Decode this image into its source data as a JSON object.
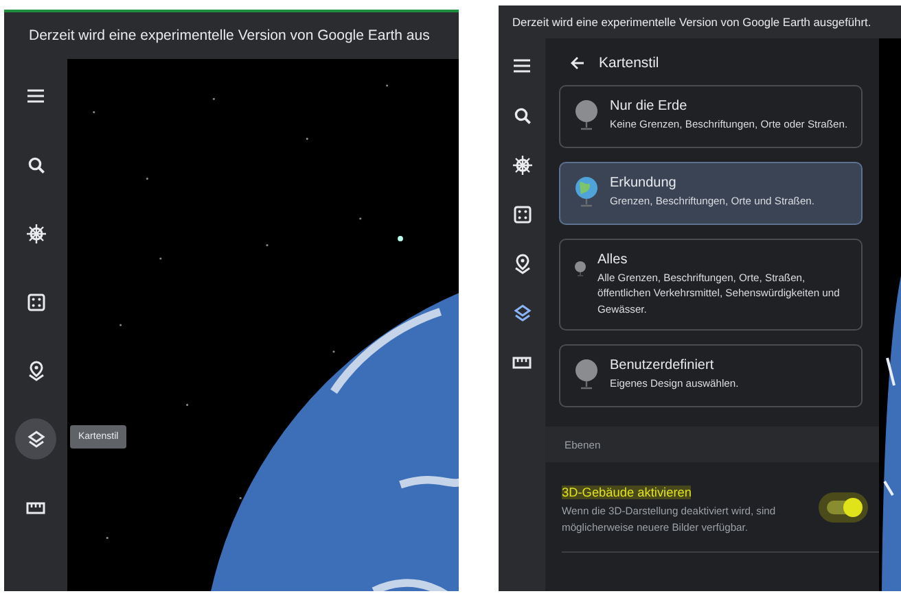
{
  "screens": [
    {
      "banner": "Derzeit wird eine experimentelle Version von Google Earth aus",
      "tooltip": "Kartenstil",
      "sidebar": [
        {
          "kind": "menu",
          "selected": false
        },
        {
          "kind": "search",
          "selected": false
        },
        {
          "kind": "wheel",
          "selected": false
        },
        {
          "kind": "dice",
          "selected": false
        },
        {
          "kind": "pin",
          "selected": false
        },
        {
          "kind": "layers",
          "selected": true
        },
        {
          "kind": "ruler",
          "selected": false
        }
      ]
    },
    {
      "banner": "Derzeit wird eine experimentelle Version von Google Earth ausgeführt.",
      "sidebar": [
        {
          "kind": "menu",
          "selected": false
        },
        {
          "kind": "search",
          "selected": false
        },
        {
          "kind": "wheel",
          "selected": false
        },
        {
          "kind": "dice",
          "selected": false
        },
        {
          "kind": "pin",
          "selected": false
        },
        {
          "kind": "layers",
          "selected": true
        },
        {
          "kind": "ruler",
          "selected": false
        }
      ],
      "panel": {
        "title": "Kartenstil",
        "styles": [
          {
            "title": "Nur die Erde",
            "description": "Keine Grenzen, Beschriftungen, Orte oder Straßen.",
            "selected": false
          },
          {
            "title": "Erkundung",
            "description": "Grenzen, Beschriftungen, Orte und Straßen.",
            "selected": true
          },
          {
            "title": "Alles",
            "description": "Alle Grenzen, Beschriftungen, Orte, Straßen, öffentlichen Verkehrsmittel, Sehenswürdigkeiten und Gewässer.",
            "selected": false
          },
          {
            "title": "Benutzerdefiniert",
            "description": "Eigenes Design auswählen.",
            "selected": false
          }
        ],
        "section": "Ebenen",
        "toggle": {
          "label": "3D-Gebäude aktivieren",
          "description": "Wenn die 3D-Darstellung deaktiviert wird, sind möglicherweise neuere Bilder verfügbar.",
          "on": true
        }
      }
    }
  ]
}
